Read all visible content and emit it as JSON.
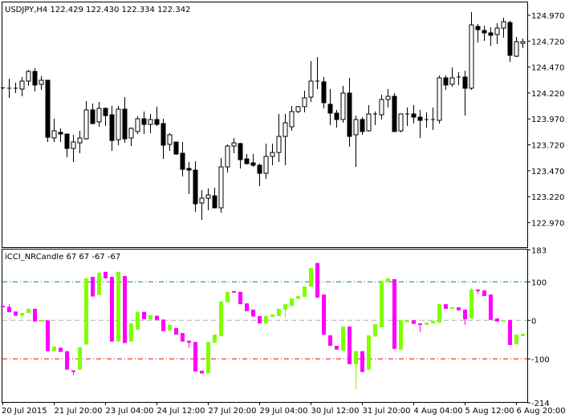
{
  "main_chart": {
    "title": "USDJPY,H4  122.429 122.430 122.334 122.342",
    "price_ticks": [
      "124.970",
      "124.720",
      "124.470",
      "124.220",
      "123.970",
      "123.720",
      "123.470",
      "123.220",
      "122.970"
    ],
    "up_color": "#ffffff",
    "down_color": "#000000"
  },
  "indicator": {
    "title": "iCCI_NRCandle 67 67 -67 -67",
    "ticks": [
      "183",
      "100",
      "0",
      "-100",
      "-214"
    ],
    "up_color": "#7fff00",
    "down_color": "#ff00ff",
    "level_colors": {
      "upper": "#008080",
      "zero": "#b0b0b0",
      "lower": "#ff0000"
    }
  },
  "time_axis": {
    "labels": [
      "20 Jul 2015",
      "21 Jul 20:00",
      "23 Jul 04:00",
      "24 Jul 12:00",
      "27 Jul 20:00",
      "29 Jul 04:00",
      "30 Jul 12:00",
      "31 Jul 20:00",
      "4 Aug 04:00",
      "5 Aug 12:00",
      "6 Aug 20:00"
    ]
  },
  "chart_data": [
    {
      "type": "candlestick",
      "symbol": "USDJPY",
      "timeframe": "H4",
      "ylim": [
        122.9,
        125.05
      ],
      "ohlc": [
        [
          124.266,
          124.273,
          124.258,
          124.27
        ],
        [
          124.266,
          124.358,
          124.173,
          124.266
        ],
        [
          124.266,
          124.32,
          124.219,
          124.266
        ],
        [
          124.258,
          124.374,
          124.188,
          124.335
        ],
        [
          124.335,
          124.444,
          124.289,
          124.428
        ],
        [
          124.428,
          124.459,
          124.235,
          124.297
        ],
        [
          124.304,
          124.382,
          124.25,
          124.343
        ],
        [
          124.343,
          124.343,
          123.747,
          123.793
        ],
        [
          123.786,
          123.971,
          123.747,
          123.855
        ],
        [
          123.84,
          123.879,
          123.747,
          123.824
        ],
        [
          123.824,
          123.824,
          123.6,
          123.685
        ],
        [
          123.685,
          123.817,
          123.554,
          123.747
        ],
        [
          123.739,
          123.855,
          123.639,
          123.786
        ],
        [
          123.778,
          124.142,
          123.77,
          124.057
        ],
        [
          124.057,
          124.119,
          123.917,
          123.925
        ],
        [
          123.941,
          124.134,
          123.894,
          124.072
        ],
        [
          124.072,
          124.08,
          123.902,
          124.002
        ],
        [
          124.01,
          124.095,
          123.662,
          123.762
        ],
        [
          123.77,
          124.095,
          123.716,
          124.064
        ],
        [
          124.064,
          124.18,
          123.739,
          123.778
        ],
        [
          123.786,
          123.886,
          123.708,
          123.879
        ],
        [
          123.848,
          123.995,
          123.824,
          123.971
        ],
        [
          123.971,
          124.041,
          123.824,
          123.917
        ],
        [
          123.917,
          124.018,
          123.832,
          123.964
        ],
        [
          123.964,
          124.088,
          123.902,
          123.917
        ],
        [
          123.925,
          123.971,
          123.584,
          123.716
        ],
        [
          123.724,
          123.832,
          123.662,
          123.817
        ],
        [
          123.747,
          123.747,
          123.623,
          123.631
        ],
        [
          123.639,
          123.747,
          123.414,
          123.484
        ],
        [
          123.492,
          123.554,
          123.244,
          123.476
        ],
        [
          123.476,
          123.561,
          123.074,
          123.151
        ],
        [
          123.159,
          123.283,
          122.996,
          123.205
        ],
        [
          123.205,
          123.298,
          123.089,
          123.236
        ],
        [
          123.228,
          123.306,
          123.112,
          123.112
        ],
        [
          123.112,
          123.592,
          123.066,
          123.507
        ],
        [
          123.507,
          123.724,
          123.453,
          123.708
        ],
        [
          123.708,
          123.786,
          123.639,
          123.739
        ],
        [
          123.732,
          123.739,
          123.492,
          123.577
        ],
        [
          123.584,
          123.631,
          123.53,
          123.538
        ],
        [
          123.546,
          123.631,
          123.507,
          123.523
        ],
        [
          123.523,
          123.538,
          123.321,
          123.445
        ],
        [
          123.445,
          123.732,
          123.391,
          123.608
        ],
        [
          123.608,
          123.732,
          123.523,
          123.646
        ],
        [
          123.646,
          124.018,
          123.554,
          123.801
        ],
        [
          123.801,
          124.018,
          123.523,
          123.933
        ],
        [
          123.894,
          124.095,
          123.855,
          124.041
        ],
        [
          124.041,
          124.095,
          124.026,
          124.088
        ],
        [
          124.088,
          124.242,
          124.033,
          124.173
        ],
        [
          124.18,
          124.529,
          124.134,
          124.335
        ],
        [
          124.335,
          124.567,
          124.258,
          124.328
        ],
        [
          124.328,
          124.374,
          124.072,
          124.126
        ],
        [
          124.111,
          124.258,
          123.91,
          124.026
        ],
        [
          124.026,
          124.057,
          123.886,
          123.964
        ],
        [
          123.964,
          124.289,
          123.933,
          124.219
        ],
        [
          124.219,
          124.366,
          123.701,
          123.801
        ],
        [
          123.817,
          124.002,
          123.507,
          123.964
        ],
        [
          123.964,
          123.987,
          123.817,
          123.848
        ],
        [
          123.855,
          124.103,
          123.848,
          124.018
        ],
        [
          124.01,
          124.041,
          123.91,
          124.018
        ],
        [
          124.01,
          124.204,
          123.964,
          124.157
        ],
        [
          124.157,
          124.258,
          124.08,
          124.188
        ],
        [
          124.188,
          124.219,
          123.848,
          123.848
        ],
        [
          123.855,
          124.018,
          123.84,
          124.018
        ],
        [
          124.018,
          124.08,
          123.902,
          124.01
        ],
        [
          124.018,
          124.103,
          123.925,
          123.987
        ],
        [
          123.987,
          124.057,
          123.786,
          123.956
        ],
        [
          123.964,
          124.033,
          123.886,
          123.956
        ],
        [
          123.964,
          124.08,
          123.863,
          123.956
        ],
        [
          123.956,
          124.389,
          123.925,
          124.366
        ],
        [
          124.366,
          124.389,
          124.25,
          124.297
        ],
        [
          124.304,
          124.467,
          124.281,
          124.366
        ],
        [
          124.374,
          124.42,
          124.297,
          124.374
        ],
        [
          124.374,
          124.436,
          124.002,
          124.266
        ],
        [
          124.266,
          125.001,
          124.25,
          124.877
        ],
        [
          124.862,
          124.885,
          124.707,
          124.831
        ],
        [
          124.823,
          124.869,
          124.722,
          124.8
        ],
        [
          124.8,
          124.854,
          124.676,
          124.776
        ],
        [
          124.784,
          124.893,
          124.691,
          124.846
        ],
        [
          124.846,
          124.947,
          124.753,
          124.908
        ],
        [
          124.9,
          124.916,
          124.521,
          124.583
        ],
        [
          124.575,
          124.761,
          124.567,
          124.715
        ],
        [
          124.699,
          124.745,
          124.653,
          124.715
        ]
      ]
    },
    {
      "type": "candlestick-indicator",
      "name": "iCCI_NRCandle",
      "ylim": [
        -214,
        183
      ],
      "levels": [
        100,
        0,
        -100
      ],
      "bars_open_close_high_low": [
        [
          38,
          35,
          38,
          35
        ],
        [
          35,
          21,
          42,
          21
        ],
        [
          23,
          12,
          23,
          12
        ],
        [
          12,
          19,
          19,
          6
        ],
        [
          19,
          30,
          30,
          19
        ],
        [
          30,
          -3,
          30,
          -3
        ],
        [
          -3,
          1,
          1,
          -3
        ],
        [
          0,
          -80,
          0,
          -80
        ],
        [
          -80,
          -68,
          -68,
          -80
        ],
        [
          -71,
          -82,
          -71,
          -82
        ],
        [
          -80,
          -128,
          -80,
          -128
        ],
        [
          -130,
          -133,
          -130,
          -142
        ],
        [
          -128,
          -70,
          -70,
          -128
        ],
        [
          -63,
          109,
          109,
          -63
        ],
        [
          113,
          62,
          113,
          62
        ],
        [
          66,
          124,
          124,
          66
        ],
        [
          126,
          109,
          126,
          109
        ],
        [
          113,
          -55,
          113,
          -55
        ],
        [
          -55,
          126,
          126,
          -55
        ],
        [
          115,
          -59,
          115,
          -59
        ],
        [
          -55,
          -8,
          -8,
          -55
        ],
        [
          -24,
          22,
          22,
          -24
        ],
        [
          22,
          3,
          22,
          3
        ],
        [
          3,
          13,
          13,
          3
        ],
        [
          12,
          1,
          12,
          1
        ],
        [
          2,
          -28,
          2,
          -28
        ],
        [
          -26,
          -12,
          -12,
          -26
        ],
        [
          -20,
          -37,
          -20,
          -37
        ],
        [
          -33,
          -55,
          -33,
          -55
        ],
        [
          -53,
          -58,
          -53,
          -71
        ],
        [
          -56,
          -133,
          -56,
          -133
        ],
        [
          -131,
          -138,
          -131,
          -138
        ],
        [
          -137,
          -56,
          -56,
          -137
        ],
        [
          -58,
          -37,
          -37,
          -58
        ],
        [
          -41,
          49,
          49,
          -41
        ],
        [
          47,
          74,
          74,
          47
        ],
        [
          76,
          72,
          76,
          72
        ],
        [
          74,
          42,
          74,
          42
        ],
        [
          44,
          24,
          44,
          24
        ],
        [
          28,
          10,
          28,
          10
        ],
        [
          11,
          -8,
          11,
          -8
        ],
        [
          -8,
          11,
          11,
          -8
        ],
        [
          9,
          15,
          15,
          9
        ],
        [
          11,
          30,
          30,
          11
        ],
        [
          28,
          42,
          42,
          6
        ],
        [
          37,
          57,
          57,
          37
        ],
        [
          56,
          63,
          63,
          56
        ],
        [
          61,
          88,
          88,
          61
        ],
        [
          88,
          136,
          136,
          88
        ],
        [
          149,
          59,
          149,
          59
        ],
        [
          67,
          -37,
          67,
          -37
        ],
        [
          -39,
          -66,
          -39,
          -66
        ],
        [
          -66,
          -76,
          -66,
          -76
        ],
        [
          -78,
          -16,
          -16,
          -78
        ],
        [
          -16,
          -114,
          -16,
          -114
        ],
        [
          -114,
          -80,
          -80,
          -180
        ],
        [
          -80,
          -134,
          -80,
          -134
        ],
        [
          -128,
          -39,
          -39,
          -128
        ],
        [
          -42,
          -10,
          -10,
          -42
        ],
        [
          -18,
          103,
          103,
          -18
        ],
        [
          100,
          109,
          109,
          100
        ],
        [
          107,
          -74,
          107,
          -74
        ],
        [
          -76,
          0,
          0,
          -76
        ],
        [
          -5,
          0,
          0,
          -5
        ],
        [
          0,
          -9,
          0,
          -9
        ],
        [
          -8,
          -12,
          -8,
          -31
        ],
        [
          -12,
          -6,
          -6,
          -12
        ],
        [
          -8,
          -1,
          -1,
          -8
        ],
        [
          -6,
          42,
          42,
          -6
        ],
        [
          42,
          30,
          42,
          30
        ],
        [
          30,
          34,
          34,
          30
        ],
        [
          34,
          26,
          34,
          26
        ],
        [
          28,
          3,
          28,
          -12
        ],
        [
          5,
          80,
          84,
          5
        ],
        [
          80,
          78,
          80,
          69
        ],
        [
          78,
          63,
          78,
          63
        ],
        [
          67,
          1,
          67,
          1
        ],
        [
          5,
          -3,
          5,
          -3
        ],
        [
          -3,
          1,
          1,
          -3
        ],
        [
          1,
          -64,
          1,
          -64
        ],
        [
          -62,
          -37,
          -37,
          -62
        ],
        [
          -41,
          -35,
          -35,
          -41
        ]
      ]
    }
  ]
}
